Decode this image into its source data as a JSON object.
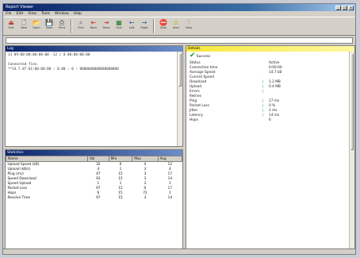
{
  "window": {
    "title": "Report Viewer"
  },
  "menu": [
    "File",
    "Edit",
    "View",
    "Tools",
    "Window",
    "Help"
  ],
  "toolbar": [
    {
      "icon": "exit-icon",
      "glyph": "⏏",
      "label": "Exit",
      "color": "#c0392b"
    },
    {
      "icon": "new-icon",
      "glyph": "🗋",
      "label": "New",
      "color": "#555"
    },
    {
      "icon": "open-icon",
      "glyph": "📂",
      "label": "Open",
      "color": "#c79a1e"
    },
    {
      "icon": "save-icon",
      "glyph": "💾",
      "label": "Save",
      "color": "#2c5aa0"
    },
    {
      "icon": "print-icon",
      "glyph": "⎙",
      "label": "Print",
      "color": "#444"
    },
    {
      "icon": "find-icon",
      "glyph": "⌕",
      "label": "Find",
      "color": "#7a2c9e"
    },
    {
      "icon": "back-icon",
      "glyph": "⇤",
      "label": "Back",
      "color": "#c0392b"
    },
    {
      "icon": "next-icon",
      "glyph": "⇥",
      "label": "Next",
      "color": "#c0392b"
    },
    {
      "icon": "grid-icon",
      "glyph": "▦",
      "label": "Grid",
      "color": "#1b7a28"
    },
    {
      "icon": "left-icon",
      "glyph": "←",
      "label": "Left",
      "color": "#2c5aa0"
    },
    {
      "icon": "right-icon",
      "glyph": "→",
      "label": "Right",
      "color": "#2c5aa0"
    },
    {
      "icon": "stop-icon",
      "glyph": "⛔",
      "label": "Stop",
      "color": "#c0392b"
    },
    {
      "icon": "warning-icon",
      "glyph": "⚠",
      "label": "Alert",
      "color": "#d4a400"
    },
    {
      "icon": "help-icon",
      "glyph": "?",
      "label": "Help",
      "color": "#aaa"
    }
  ],
  "log_pane": {
    "title": "Log",
    "lines": [
      "13 09:00:00:00:00:00 -12 / 0 00:00:00:00",
      "",
      "Connected fine.",
      "**14.7.07 01:00:00:00 : 0.00 : 0 : 0000000000000000000"
    ]
  },
  "stats_pane": {
    "title": "Statistics",
    "columns": [
      "Name",
      "Val",
      "Min",
      "Max",
      "Avg"
    ],
    "rows": [
      [
        "Upload Speed (kB)",
        "32",
        "0",
        "4",
        "12"
      ],
      [
        "Upload (kB/s)",
        "4",
        "1",
        "3",
        "4"
      ],
      [
        "Ping (ms)",
        "47",
        "15",
        "3",
        "17"
      ],
      [
        "Speed Download",
        "93",
        "15",
        "3",
        "14"
      ],
      [
        "Speed Upload",
        "1",
        "1",
        "3",
        "1"
      ],
      [
        "Packet Loss",
        "97",
        "15",
        "0",
        "17"
      ],
      [
        "Hops",
        "6",
        "15",
        "72",
        "1"
      ],
      [
        "Resolve Time",
        "97",
        "15",
        "3",
        "14"
      ]
    ]
  },
  "details_pane": {
    "title": "Details",
    "status": "Success",
    "rows": [
      {
        "k": "Status",
        "m": "",
        "v": "Active"
      },
      {
        "k": "Connection time",
        "m": "",
        "v": "0:00:00"
      },
      {
        "k": "Average Speed",
        "m": "",
        "v": "14.7 kB"
      },
      {
        "k": "Current Speed",
        "m": "",
        "v": ""
      },
      {
        "k": "Download",
        "m": "|",
        "v": "1.2 MB"
      },
      {
        "k": "Upload",
        "m": "|",
        "v": "0.4 MB"
      },
      {
        "k": "Errors",
        "m": "|",
        "v": ""
      },
      {
        "k": "Retries",
        "m": "",
        "v": ""
      },
      {
        "k": "Ping",
        "m": "|",
        "v": "17 ms"
      },
      {
        "k": "Packet Loss",
        "m": "|",
        "v": "0 %"
      },
      {
        "k": "Jitter",
        "m": "|",
        "v": "2 ms"
      },
      {
        "k": "Latency",
        "m": "|",
        "v": "14 ms"
      },
      {
        "k": "Hops",
        "m": "",
        "v": "6"
      }
    ]
  }
}
